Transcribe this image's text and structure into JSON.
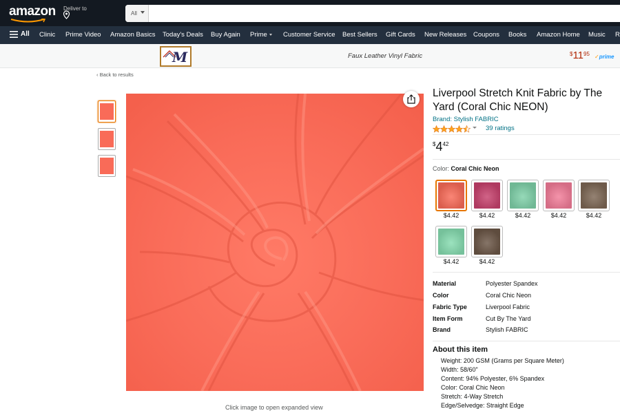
{
  "header": {
    "logo_text": "amazon",
    "deliver_label": "Deliver to",
    "search": {
      "category": "All",
      "placeholder": "",
      "value": ""
    }
  },
  "subnav": {
    "all_label": "All",
    "items": [
      "Clinic",
      "Prime Video",
      "Amazon Basics",
      "Today's Deals",
      "Buy Again",
      "Prime",
      "Customer Service",
      "Best Sellers",
      "Gift Cards",
      "New Releases",
      "Coupons",
      "Books",
      "Amazon Home",
      "Music",
      "Re"
    ]
  },
  "brand_strip": {
    "logo_letter": "M",
    "title": "Faux Leather Vinyl Fabric",
    "price_symbol": "$",
    "price_whole": "11",
    "price_fraction": "95",
    "prime_label": "prime"
  },
  "breadcrumb": {
    "back_label": "‹ Back to results"
  },
  "gallery": {
    "thumb_count": 3,
    "hint": "Click image to open expanded view",
    "main_color": "#f96b58"
  },
  "product": {
    "title": "Liverpool Stretch Knit Fabric by The Yard (Coral Chic NEON)",
    "brand": "Brand: Stylish FABRIC",
    "rating": 4.5,
    "ratings_count": "39 ratings",
    "price_symbol": "$",
    "price_whole": "4",
    "price_fraction": "42",
    "color_label": "Color:",
    "color_value": "Coral Chic Neon",
    "variants": [
      {
        "color": "#f96b58",
        "price": "$4.42",
        "selected": true
      },
      {
        "color": "#c7416d",
        "price": "$4.42",
        "selected": false
      },
      {
        "color": "#7fd1a9",
        "price": "$4.42",
        "selected": false
      },
      {
        "color": "#f27c98",
        "price": "$4.42",
        "selected": false
      },
      {
        "color": "#7d6754",
        "price": "$4.42",
        "selected": false
      },
      {
        "color": "#86dcb0",
        "price": "$4.42",
        "selected": false
      },
      {
        "color": "#6b5646",
        "price": "$4.42",
        "selected": false
      }
    ],
    "specs": [
      {
        "key": "Material",
        "value": "Polyester Spandex"
      },
      {
        "key": "Color",
        "value": "Coral Chic Neon"
      },
      {
        "key": "Fabric Type",
        "value": "Liverpool Fabric"
      },
      {
        "key": "Item Form",
        "value": "Cut By The Yard"
      },
      {
        "key": "Brand",
        "value": "Stylish FABRIC"
      }
    ],
    "about_heading": "About this item",
    "bullets": [
      "Weight: 200 GSM (Grams per Square Meter)",
      "Width: 58/60\"",
      "Content: 94% Polyester, 6% Spandex",
      "Color: Coral Chic Neon",
      "Stretch: 4-Way Stretch",
      "Edge/Selvedge: Straight Edge"
    ]
  },
  "colors": {
    "nav_bg": "#131921",
    "subnav_bg": "#232f3e",
    "link": "#007185",
    "price_red": "#b12704",
    "star": "#ffa41c",
    "selected_border": "#e77600"
  }
}
